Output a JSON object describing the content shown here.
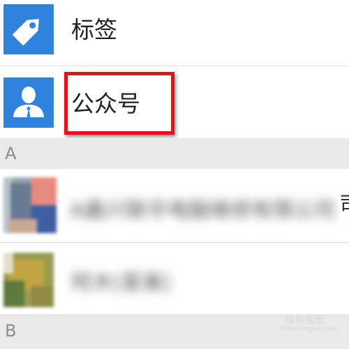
{
  "contacts_menu": {
    "tags": {
      "label": "标签",
      "icon": "tag-icon"
    },
    "official_accounts": {
      "label": "公众号",
      "icon": "person-tie-icon"
    }
  },
  "sections": [
    {
      "letter": "A",
      "contacts": [
        {
          "name": "A鑫兴联华电脑维修有限公司"
        },
        {
          "name": "阿木(爱美)"
        }
      ]
    },
    {
      "letter": "B"
    }
  ],
  "watermark": {
    "brand": "搜狗指南",
    "url": "zhinan.sogou.com"
  },
  "colors": {
    "icon_bg": "#2f83dc",
    "section_bg": "#e9e9e9",
    "highlight": "#e0141b"
  }
}
